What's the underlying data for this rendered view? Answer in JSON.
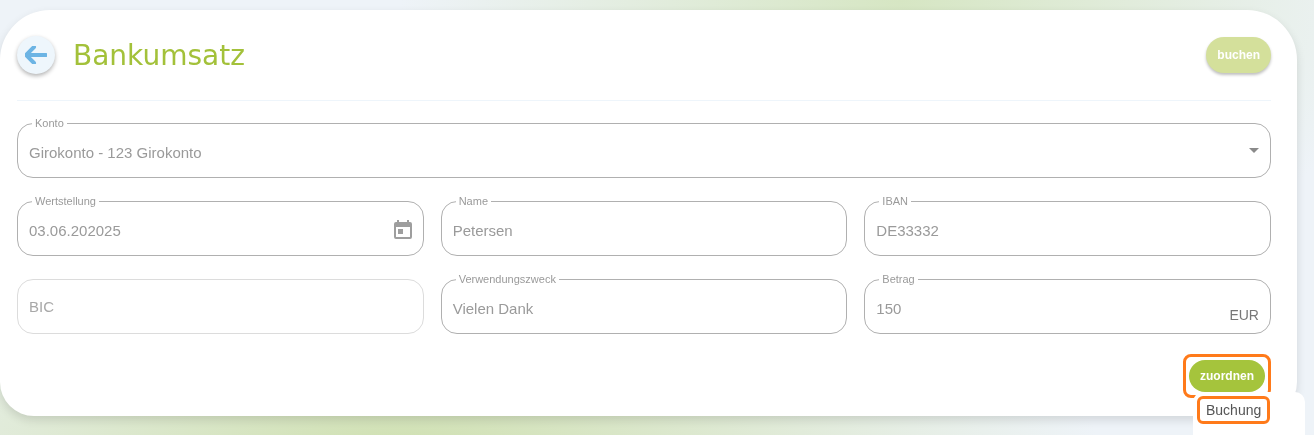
{
  "header": {
    "title": "Bankumsatz",
    "book_button": {
      "label": "buchen",
      "disabled": true
    }
  },
  "fields": [
    {
      "kind": "select",
      "label": "Konto",
      "value": "Girokonto - 123 Girokonto"
    },
    {
      "kind": "date",
      "label": "Wertstellung",
      "value": "03.06.202025"
    },
    {
      "kind": "text",
      "label": "Name",
      "value": "Petersen"
    },
    {
      "kind": "text",
      "label": "IBAN",
      "value": "DE33332"
    },
    {
      "kind": "text",
      "placeholder": "BIC"
    },
    {
      "kind": "text",
      "label": "Verwendungszweck",
      "value": "Vielen Dank"
    },
    {
      "kind": "amount",
      "label": "Betrag",
      "value": "150",
      "unit": "EUR"
    }
  ],
  "assign_button": {
    "label": "zuordnen",
    "disabled": false,
    "highlighted": true
  },
  "menu": {
    "items": [
      {
        "label": "Buchung",
        "highlighted": true
      }
    ]
  }
}
